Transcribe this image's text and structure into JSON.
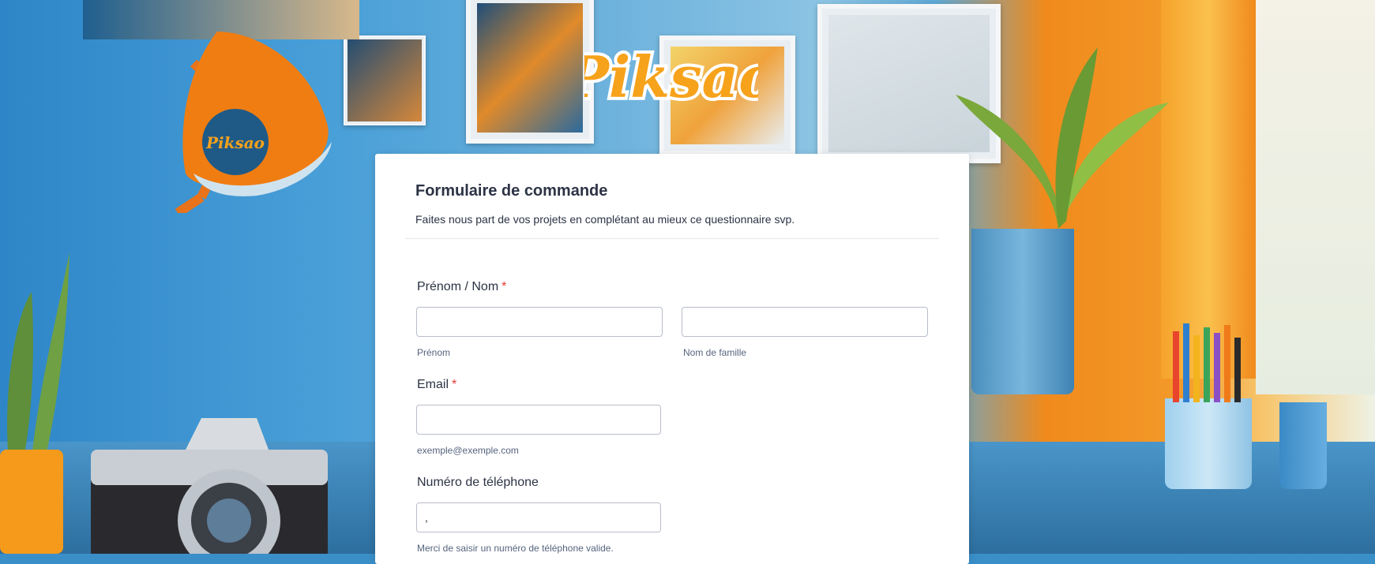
{
  "brand": {
    "logo_text": "Piksao",
    "lamp_badge_text": "Piksao"
  },
  "colors": {
    "accent_orange": "#f7a21b",
    "required_red": "#e53935",
    "text_dark": "#2c3345",
    "text_muted": "#57647e"
  },
  "form": {
    "title": "Formulaire de commande",
    "subtitle": "Faites nous part de vos projets en complétant au mieux ce questionnaire svp.",
    "name_field": {
      "label": "Prénom / Nom",
      "required_mark": "*",
      "first_value": "",
      "last_value": "",
      "first_sublabel": "Prénom",
      "last_sublabel": "Nom de famille"
    },
    "email_field": {
      "label": "Email",
      "required_mark": "*",
      "value": "",
      "sublabel": "exemple@exemple.com"
    },
    "phone_field": {
      "label": "Numéro de téléphone",
      "value": ",",
      "sublabel": "Merci de saisir un numéro de téléphone valide."
    }
  }
}
